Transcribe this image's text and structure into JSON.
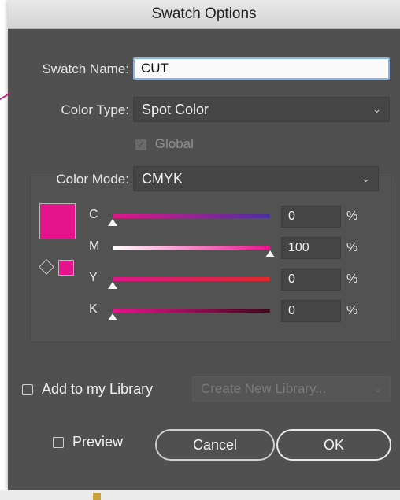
{
  "dialog": {
    "title": "Swatch Options"
  },
  "swatch_name": {
    "label": "Swatch Name:",
    "value": "CUT"
  },
  "color_type": {
    "label": "Color Type:",
    "selected": "Spot Color"
  },
  "global": {
    "label": "Global",
    "checked": true,
    "disabled": true
  },
  "color_mode": {
    "label": "Color Mode:",
    "selected": "CMYK"
  },
  "swatch_color": "#e6148c",
  "channels": [
    {
      "letter": "C",
      "value": "0",
      "unit": "%",
      "level": 0,
      "gradient": "linear-gradient(90deg,#e6148c,#4a2fa0)"
    },
    {
      "letter": "M",
      "value": "100",
      "unit": "%",
      "level": 1,
      "gradient": "linear-gradient(90deg,#ffffff,#e6148c)"
    },
    {
      "letter": "Y",
      "value": "0",
      "unit": "%",
      "level": 0,
      "gradient": "linear-gradient(90deg,#e6148c,#e6262a)"
    },
    {
      "letter": "K",
      "value": "0",
      "unit": "%",
      "level": 0,
      "gradient": "linear-gradient(90deg,#e6148c,#3a0a1a)"
    }
  ],
  "library": {
    "label": "Add to my Library",
    "checked": false,
    "dropdown": "Create New Library..."
  },
  "preview": {
    "label": "Preview",
    "checked": false
  },
  "buttons": {
    "cancel": "Cancel",
    "ok": "OK"
  }
}
